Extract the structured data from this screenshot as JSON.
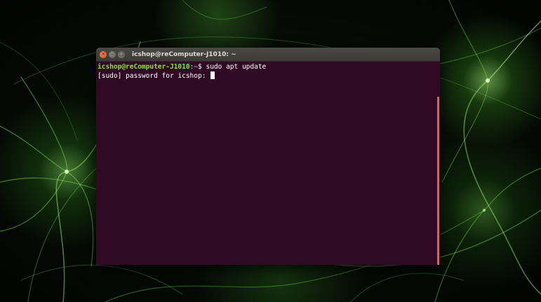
{
  "window": {
    "title": "icshop@reComputer-J1010: ~",
    "controls": {
      "close_glyph": "×",
      "minimize_glyph": "–",
      "maximize_glyph": "□"
    }
  },
  "terminal": {
    "lines": [
      {
        "user_host": "icshop@reComputer-J1010",
        "separator": ":",
        "path": "~",
        "symbol": "$ ",
        "command": "sudo apt update"
      },
      {
        "text": "[sudo] password for icshop: "
      }
    ]
  },
  "colors": {
    "terminal_background": "#300a24",
    "prompt_user": "#8ae234",
    "prompt_path": "#729fcf",
    "scrollbar": "#e0643c",
    "titlebar": "#3c3b37"
  }
}
